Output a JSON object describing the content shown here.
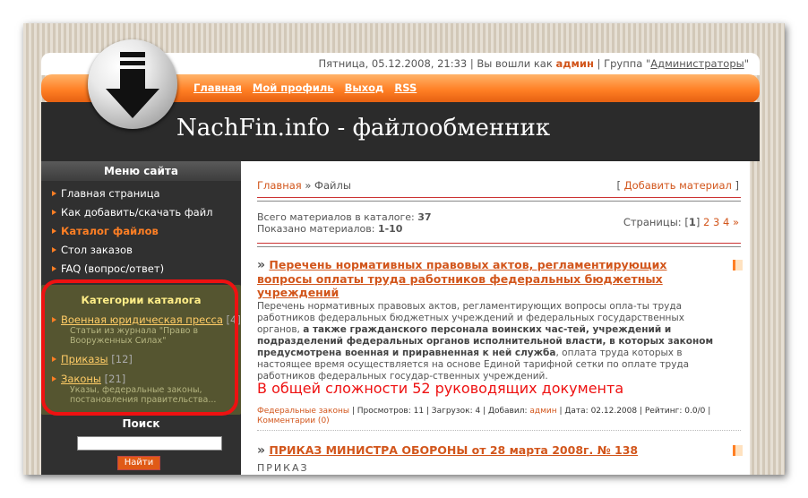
{
  "topbar": {
    "date": "Пятница, 05.12.2008, 21:33",
    "logged_prefix": " | Вы вошли как ",
    "user": "админ",
    "group_prefix": " | Группа \"",
    "group": "Администраторы",
    "group_suffix": "\""
  },
  "nav": {
    "home": "Главная",
    "profile": "Мой профиль",
    "logout": "Выход",
    "rss": "RSS"
  },
  "site_title": "NachFin.info - файлообменник",
  "sidebar": {
    "menu_title": "Меню сайта",
    "menu": [
      {
        "label": "Главная страница"
      },
      {
        "label": "Как добавить/скачать файл"
      },
      {
        "label": "Каталог файлов"
      },
      {
        "label": "Стол заказов"
      },
      {
        "label": "FAQ (вопрос/ответ)"
      }
    ],
    "categories_title": "Категории каталога",
    "categories": [
      {
        "name": "Военная юридическая пресса",
        "count": "[4]",
        "desc": "Статьи из журнала \"Право в Вооруженных Силах\""
      },
      {
        "name": "Приказы",
        "count": "[12]",
        "desc": ""
      },
      {
        "name": "Законы",
        "count": "[21]",
        "desc": "Указы, федеральные законы, постановления правительства..."
      }
    ],
    "search_title": "Поиск",
    "search_button": "Найти"
  },
  "content": {
    "crumb_home": "Главная",
    "crumb_sep": " » ",
    "crumb_current": "Файлы",
    "add_material": "Добавить материал",
    "stats_total_label": "Всего материалов в каталоге: ",
    "stats_total": "37",
    "stats_shown_label": "Показано материалов: ",
    "stats_shown": "1-10",
    "pages_label": "Страницы: ",
    "pages_current": "1",
    "pages": [
      "2",
      "3",
      "4",
      "»"
    ],
    "entries": [
      {
        "title": "Перечень нормативных правовых актов, регламентирующих вопросы оплаты труда работников федеральных бюджетных учреждений",
        "text_a": "Перечень нормативных правовых актов, регламентирующих вопросы опла-ты труда работников федеральных бюджетных учреждений и федеральных государственных органов, ",
        "text_b": "а также гражданского персонала воинских час-тей, учреждений и подразделений федеральных органов исполнительной власти, в которых законом предусмотрена военная и приравненная к ней служба",
        "text_c": ", оплата труда которых в настоящее время осуществляется на основе Единой тарифной сетки по оплате труда работников федеральных государ-ственных учреждений.",
        "highlight": "В общей сложности 52 руководящих документа",
        "category": "Федеральные законы",
        "views": " | Просмотров: 11 | Загрузок: 4 | Добавил: ",
        "author": "админ",
        "date_rating": " | Дата: 02.12.2008 | Рейтинг: 0.0/0 |",
        "comments": "Комментарии (0)"
      },
      {
        "title": "ПРИКАЗ МИНИСТРА ОБОРОНЫ от 28 марта 2008г. № 138",
        "first_line": "ПРИКАЗ"
      }
    ]
  }
}
